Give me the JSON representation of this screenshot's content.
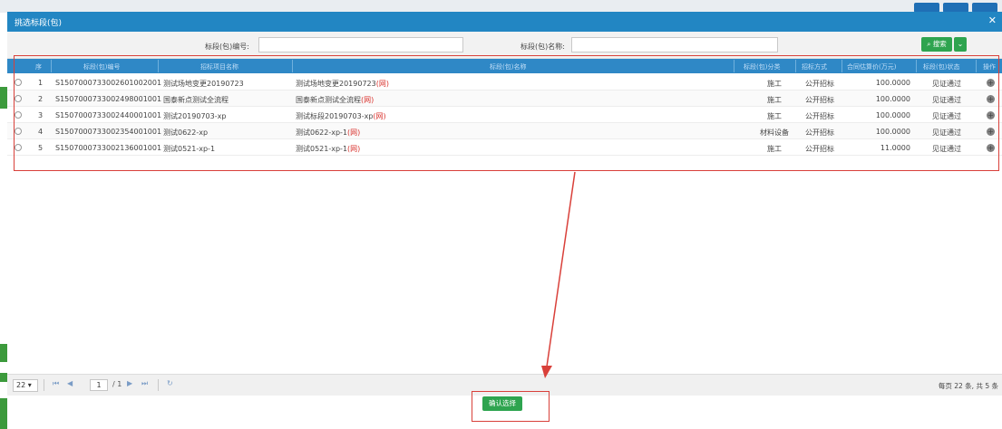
{
  "dialog": {
    "title": "挑选标段(包)",
    "close_icon": "close-icon"
  },
  "search": {
    "code_label": "标段(包)编号:",
    "code_value": "",
    "name_label": "标段(包)名称:",
    "name_value": "",
    "search_button": "搜索",
    "search_icon": "search-icon",
    "more_icon": "chevron-down-icon"
  },
  "grid": {
    "columns": [
      "序",
      "标段(包)编号",
      "招标项目名称",
      "标段(包)名称",
      "标段(包)分类",
      "招标方式",
      "合同估算价(万元)",
      "标段(包)状态",
      "操作"
    ],
    "rows": [
      {
        "index": "1",
        "code": "S1507000733002601002001",
        "project": "测试场地变更20190723",
        "name": "测试场地变更20190723",
        "tag": "(网)",
        "category": "施工",
        "method": "公开招标",
        "price": "100.0000",
        "status": "见证通过"
      },
      {
        "index": "2",
        "code": "S1507000733002498001001",
        "project": "国泰新点测试全流程",
        "name": "国泰新点测试全流程",
        "tag": "(网)",
        "category": "施工",
        "method": "公开招标",
        "price": "100.0000",
        "status": "见证通过"
      },
      {
        "index": "3",
        "code": "S1507000733002440001001",
        "project": "测试20190703-xp",
        "name": "测试标段20190703-xp",
        "tag": "(网)",
        "category": "施工",
        "method": "公开招标",
        "price": "100.0000",
        "status": "见证通过"
      },
      {
        "index": "4",
        "code": "S1507000733002354001001",
        "project": "测试0622-xp",
        "name": "测试0622-xp-1",
        "tag": "(网)",
        "category": "材料设备",
        "method": "公开招标",
        "price": "100.0000",
        "status": "见证通过"
      },
      {
        "index": "5",
        "code": "S1507000733002136001001",
        "project": "测试0521-xp-1",
        "name": "测试0521-xp-1",
        "tag": "(网)",
        "category": "施工",
        "method": "公开招标",
        "price": "11.0000",
        "status": "见证通过"
      }
    ],
    "add_icon": "plus-circle-icon"
  },
  "pager": {
    "page_size": "22",
    "first_icon": "first-page-icon",
    "prev_icon": "prev-page-icon",
    "current_page": "1",
    "total_pages": "/ 1",
    "next_icon": "next-page-icon",
    "last_icon": "last-page-icon",
    "refresh_icon": "refresh-icon",
    "info": "每页 22 条, 共 5 条"
  },
  "footer": {
    "confirm_button": "确认选择"
  },
  "colors": {
    "titlebar": "#2286c3",
    "header": "#2f88c6",
    "primary_button": "#2ea44f",
    "annotation": "#d9403a",
    "tag": "#d9332e"
  }
}
